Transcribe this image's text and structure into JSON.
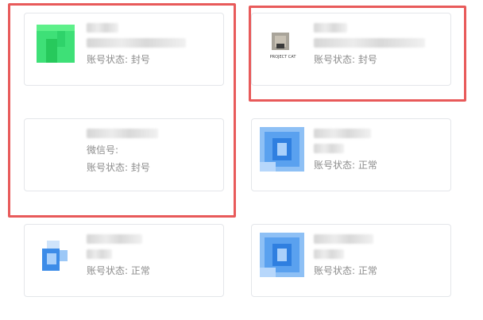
{
  "accounts": [
    {
      "status_text": "账号状态: 封号",
      "avatar_icon": "green-app-icon",
      "has_wechat_label": false
    },
    {
      "status_text": "账号状态: 封号",
      "avatar_icon": "project-cat-icon",
      "has_wechat_label": false,
      "avatar_caption": "PROJECT CAT"
    },
    {
      "status_text": "账号状态: 封号",
      "wechat_label": "微信号:",
      "has_wechat_label": true,
      "avatar_icon": "none"
    },
    {
      "status_text": "账号状态: 正常",
      "avatar_icon": "blue-app-icon",
      "has_wechat_label": false
    },
    {
      "status_text": "账号状态: 正常",
      "avatar_icon": "blue-app-icon-small",
      "has_wechat_label": false
    },
    {
      "status_text": "账号状态: 正常",
      "avatar_icon": "blue-app-icon",
      "has_wechat_label": false
    }
  ],
  "colors": {
    "highlight_border": "#e85a5a",
    "status_text": "#8c8c8c",
    "green_icon": "#3ee077",
    "blue_icon": "#4a90e2"
  }
}
